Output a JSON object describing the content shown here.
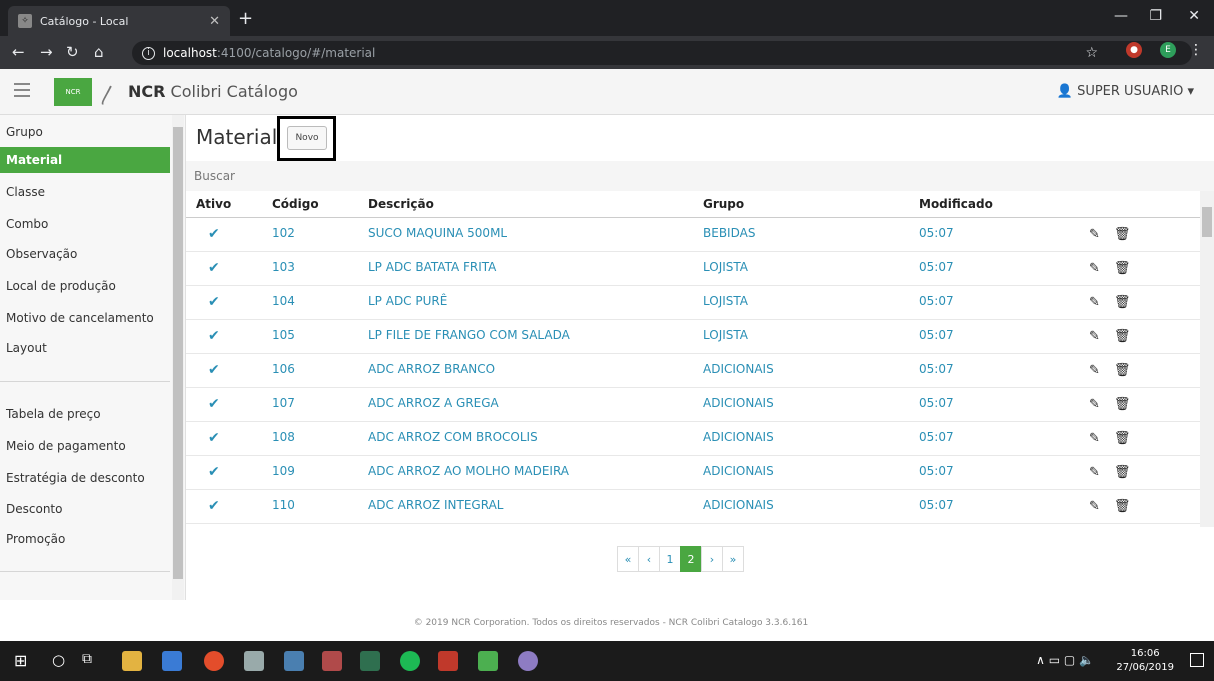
{
  "browser": {
    "tab_title": "Catálogo - Local",
    "url_host": "localhost",
    "url_path": ":4100/catalogo/#/material"
  },
  "app": {
    "brand_strong": "NCR",
    "brand_rest": " Colibri Catálogo",
    "logo_text": "NCR",
    "user": "SUPER USUARIO"
  },
  "sidebar": {
    "items": [
      "Grupo",
      "Material",
      "Classe",
      "Combo",
      "Observação",
      "Local de produção",
      "Motivo de cancelamento",
      "Layout"
    ],
    "items2": [
      "Tabela de preço",
      "Meio de pagamento",
      "Estratégia de desconto",
      "Desconto",
      "Promoção"
    ],
    "active": "Material"
  },
  "main": {
    "title": "Material",
    "new_button": "Novo",
    "search_placeholder": "Buscar",
    "columns": [
      "Ativo",
      "Código",
      "Descrição",
      "Grupo",
      "Modificado"
    ],
    "rows": [
      {
        "code": "102",
        "desc": "SUCO MAQUINA 500ML",
        "group": "BEBIDAS",
        "modified": "05:07"
      },
      {
        "code": "103",
        "desc": "LP ADC BATATA FRITA",
        "group": "LOJISTA",
        "modified": "05:07"
      },
      {
        "code": "104",
        "desc": "LP ADC PURÊ",
        "group": "LOJISTA",
        "modified": "05:07"
      },
      {
        "code": "105",
        "desc": "LP FILE DE FRANGO COM SALADA",
        "group": "LOJISTA",
        "modified": "05:07"
      },
      {
        "code": "106",
        "desc": "ADC ARROZ BRANCO",
        "group": "ADICIONAIS",
        "modified": "05:07"
      },
      {
        "code": "107",
        "desc": "ADC ARROZ A GREGA",
        "group": "ADICIONAIS",
        "modified": "05:07"
      },
      {
        "code": "108",
        "desc": "ADC ARROZ COM BROCOLIS",
        "group": "ADICIONAIS",
        "modified": "05:07"
      },
      {
        "code": "109",
        "desc": "ADC ARROZ AO MOLHO MADEIRA",
        "group": "ADICIONAIS",
        "modified": "05:07"
      },
      {
        "code": "110",
        "desc": "ADC ARROZ INTEGRAL",
        "group": "ADICIONAIS",
        "modified": "05:07"
      }
    ],
    "pager": [
      "«",
      "‹",
      "1",
      "2",
      "›",
      "»"
    ],
    "current_page": "2"
  },
  "footer": "© 2019 NCR Corporation. Todos os direitos reservados - NCR Colibri Catalogo 3.3.6.161",
  "taskbar": {
    "time": "16:06",
    "date": "27/06/2019"
  },
  "colors": {
    "accent": "#4aa741",
    "link": "#2a8fb5"
  }
}
